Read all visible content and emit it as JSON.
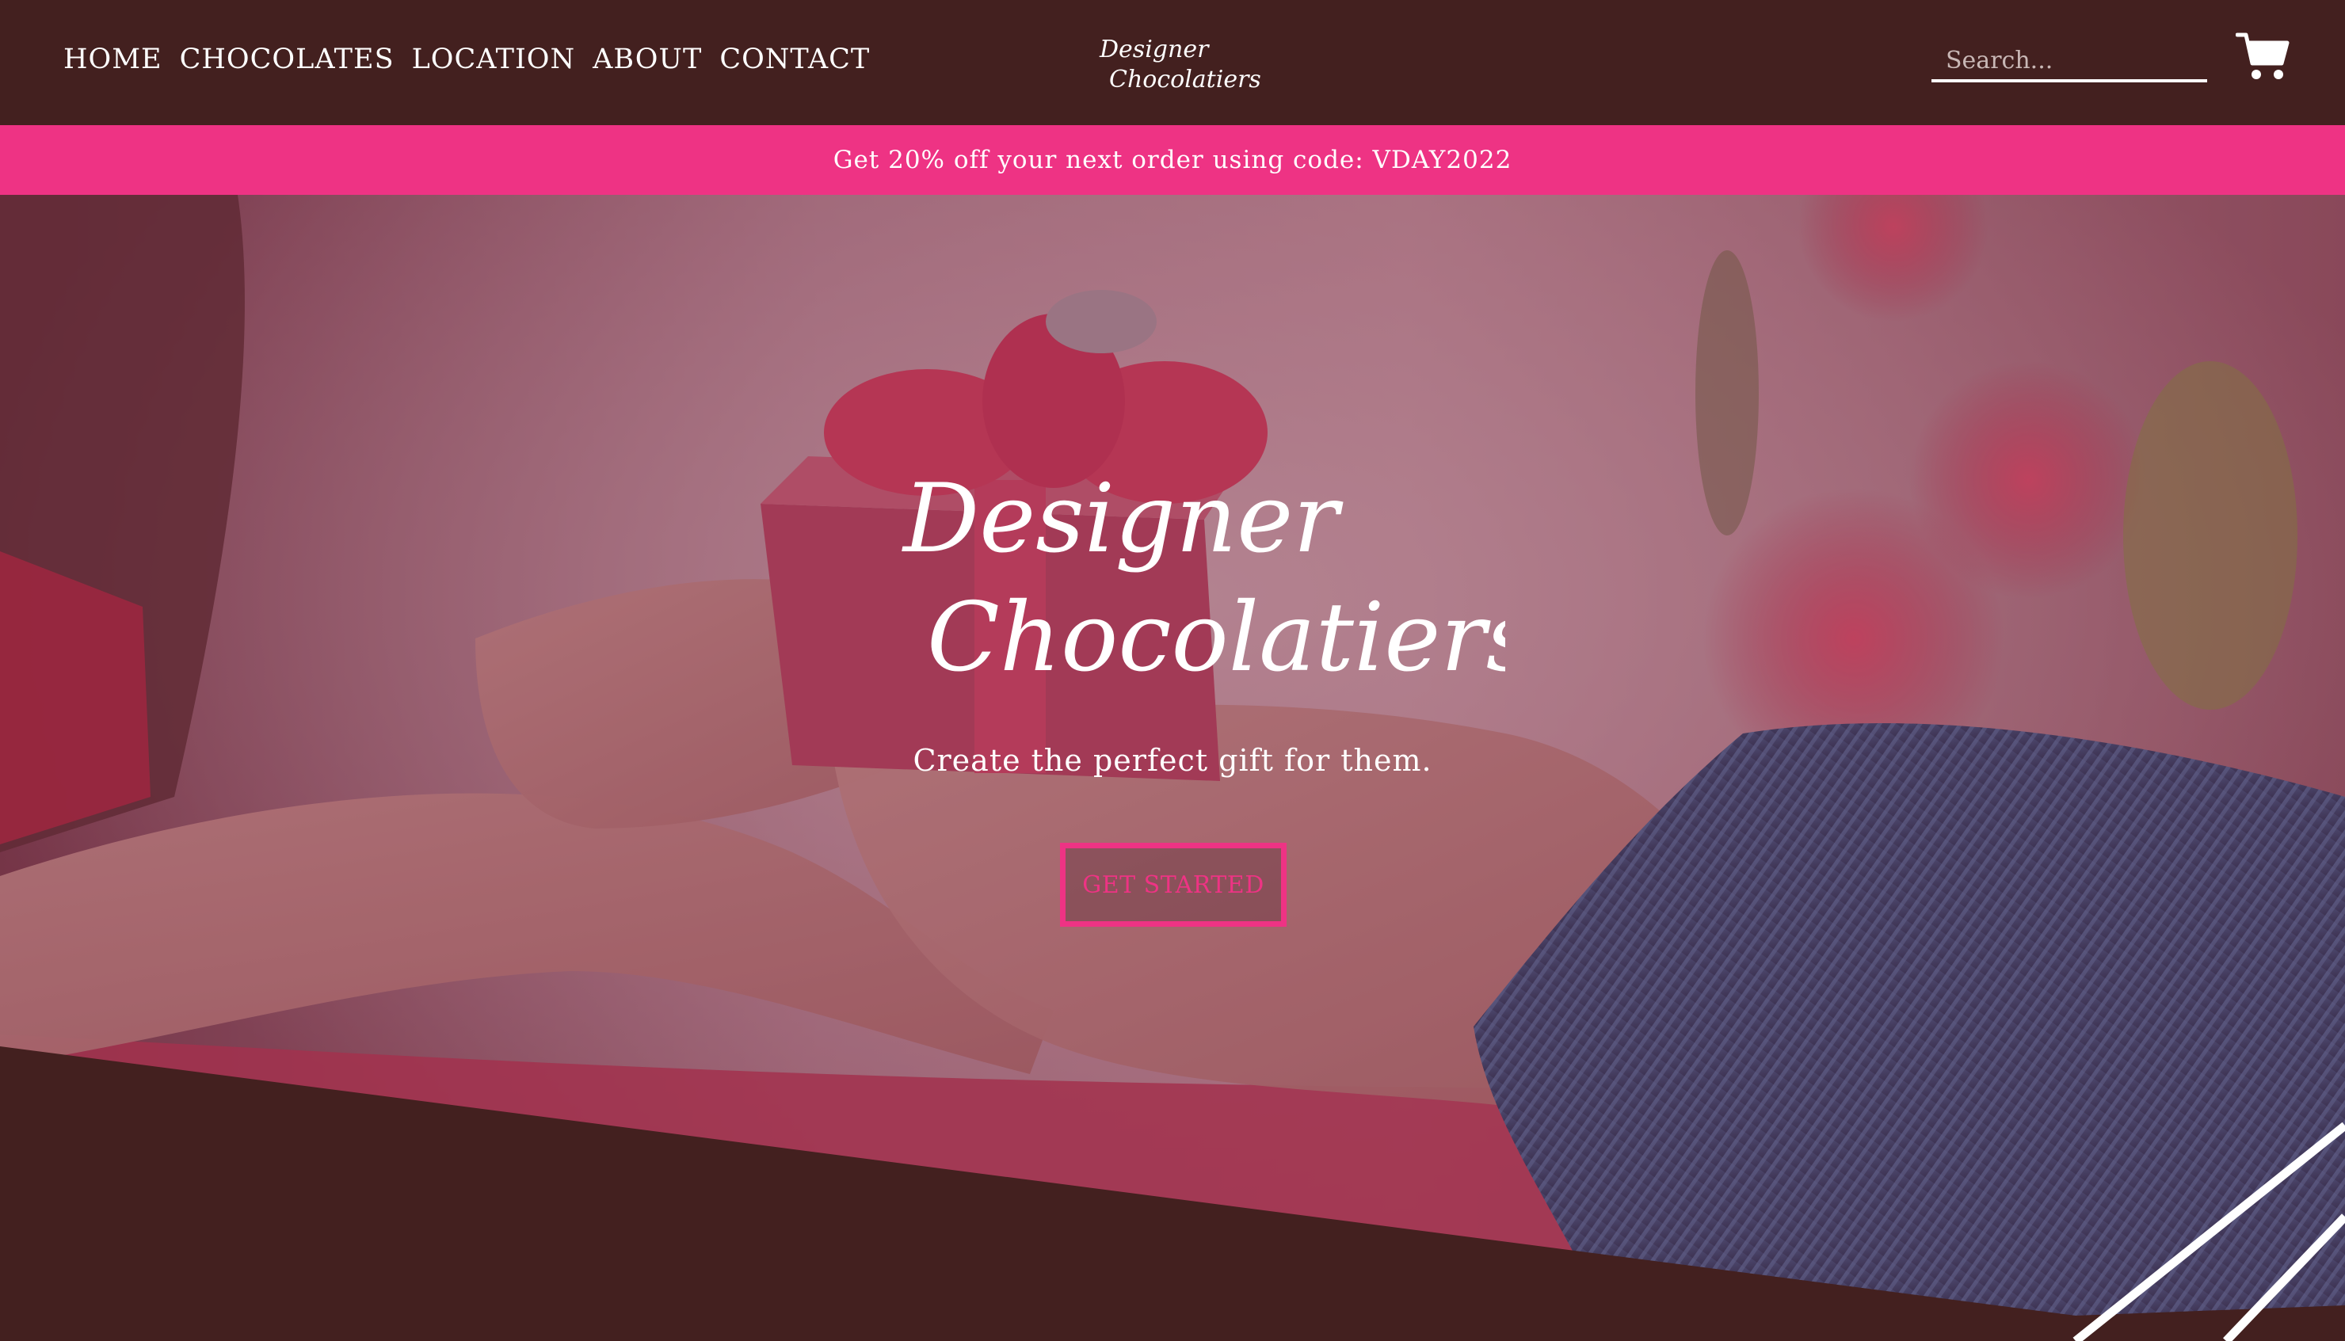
{
  "nav": {
    "items": [
      {
        "label": "HOME"
      },
      {
        "label": "CHOCOLATES"
      },
      {
        "label": "LOCATION"
      },
      {
        "label": "ABOUT"
      },
      {
        "label": "CONTACT"
      }
    ]
  },
  "logo": {
    "line1": "Designer",
    "line2": "Chocolatiers"
  },
  "search": {
    "placeholder": "Search..."
  },
  "cart": {
    "icon": "shopping-cart-icon"
  },
  "promo": {
    "text": "Get 20% off your next order using code: VDAY2022"
  },
  "hero": {
    "title_line1": "Designer",
    "title_line2": "Chocolatiers",
    "subtitle": "Create the perfect gift for them.",
    "cta_label": "GET STARTED"
  },
  "colors": {
    "header_bg": "#43201f",
    "accent_pink": "#ee3384",
    "text": "#ffffff"
  }
}
